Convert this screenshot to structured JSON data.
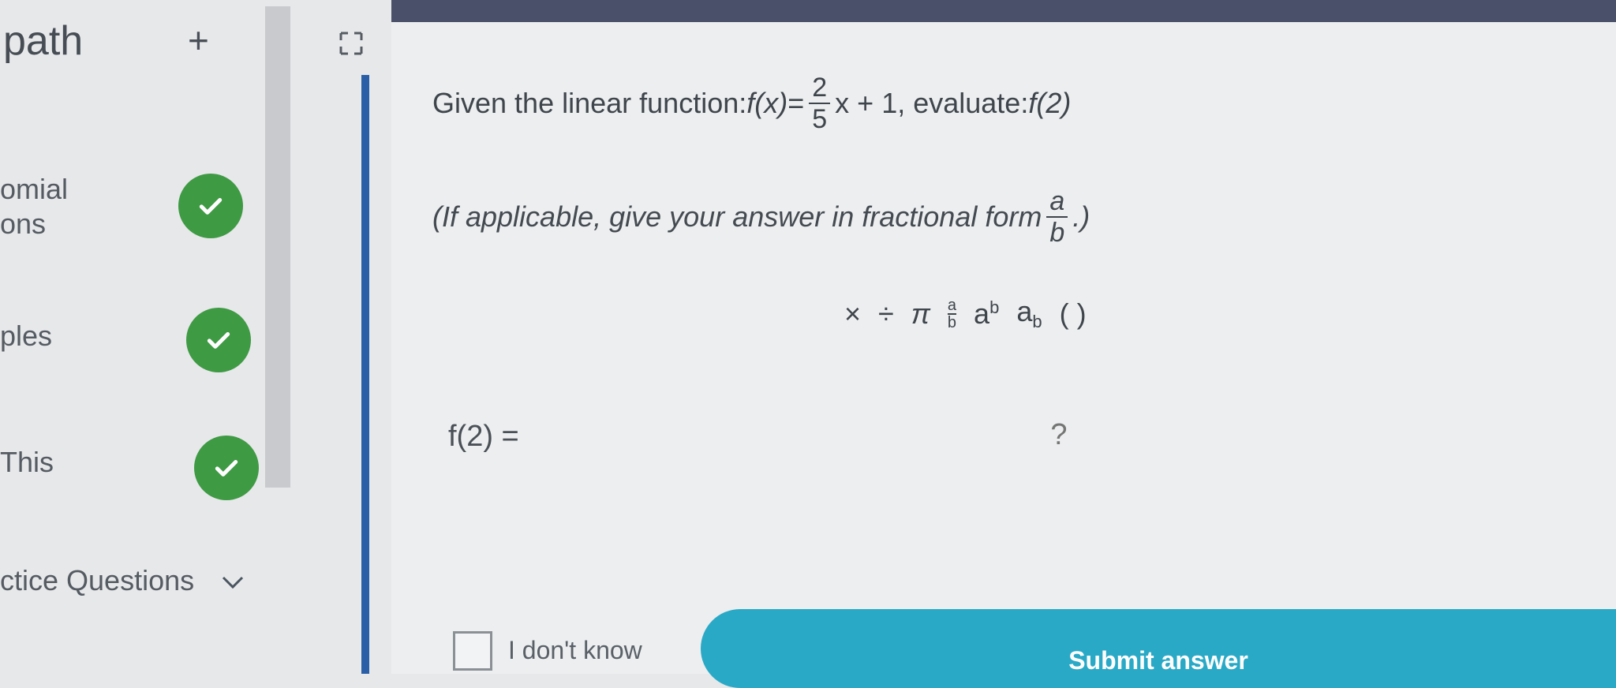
{
  "sidebar": {
    "title": "path",
    "add_label": "+",
    "items": [
      {
        "label_line1": "omial",
        "label_line2": "ons",
        "completed": true
      },
      {
        "label_line1": "ples",
        "label_line2": "",
        "completed": true
      },
      {
        "label_line1": "This",
        "label_line2": "",
        "completed": true
      }
    ],
    "practice_label": "ctice Questions"
  },
  "question": {
    "prefix": "Given the linear function: ",
    "fx": "f(x)",
    "equals": " = ",
    "frac_num": "2",
    "frac_den": "5",
    "after_frac": "x + 1, evaluate: ",
    "evaluate": "f(2)",
    "hint_prefix": "(If applicable, give your answer in fractional form ",
    "hint_frac_num": "a",
    "hint_frac_den": "b",
    "hint_suffix": ".)"
  },
  "toolbar": {
    "times": "×",
    "divide": "÷",
    "pi": "π",
    "frac_num": "a",
    "frac_den": "b",
    "power_base": "a",
    "power_exp": "b",
    "sub_base": "a",
    "sub_index": "b",
    "parens": "( )"
  },
  "answer": {
    "label": "f(2) =",
    "placeholder": "?"
  },
  "footer": {
    "dont_know_label": "I don't know",
    "submit_label": "Submit answer"
  },
  "colors": {
    "check_green": "#3f9a44",
    "submit_blue": "#2aa9c7",
    "topbar": "#4a4f6a",
    "divider_blue": "#2a5fa8"
  }
}
